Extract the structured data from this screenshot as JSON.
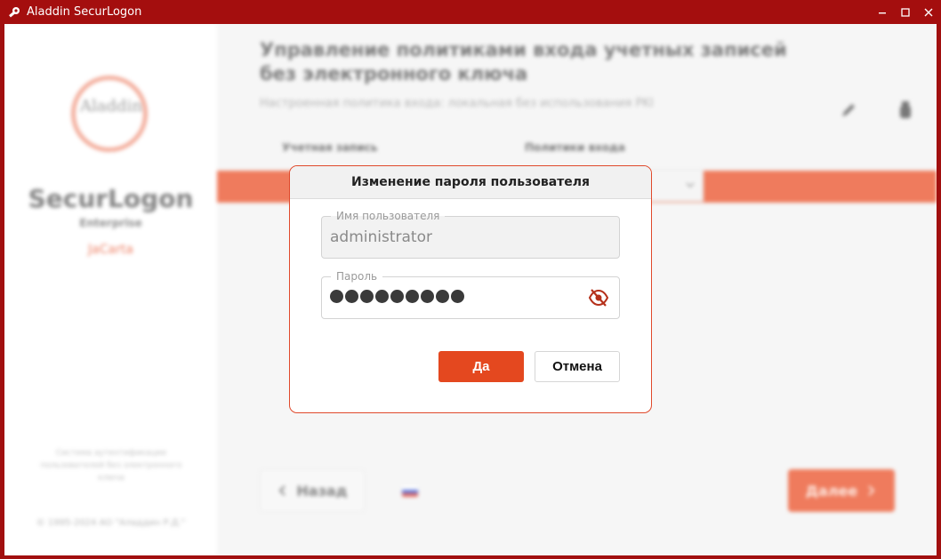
{
  "window": {
    "title": "Aladdin SecurLogon",
    "accent_color": "#a40e0e"
  },
  "sidebar": {
    "logo_text": "Aladdin",
    "product_name": "SecurLogon",
    "edition": "Enterprise",
    "partner": "JaCarta",
    "note": "Система аутентификации пользователей без электронного ключа",
    "copyright": "© 1995-2024 АО \"Аладдин Р.Д.\""
  },
  "main": {
    "title": "Управление политиками входа учетных записей без электронного ключа",
    "subtitle": "Настроенная политика входа: локальная без использования PKI",
    "columns": [
      "Учетная запись",
      "Политики входа"
    ],
    "back_label": "Назад",
    "next_label": "Далее",
    "brand_color": "#e9491f"
  },
  "dialog": {
    "title": "Изменение пароля пользователя",
    "username": {
      "label": "Имя пользователя",
      "value": "administrator"
    },
    "password": {
      "label": "Пароль",
      "masked_length": 9,
      "visibility_icon": "eye-off-icon"
    },
    "ok_label": "Да",
    "cancel_label": "Отмена",
    "accent_color": "#e4481f"
  }
}
